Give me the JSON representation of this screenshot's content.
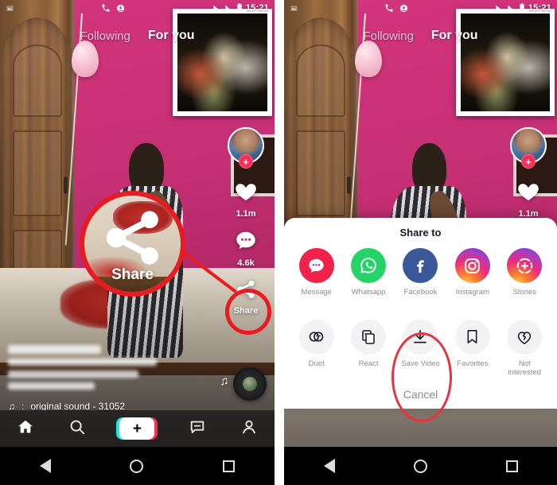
{
  "meta": {
    "description": "Two Android phone screenshots side by side showing TikTok video feed and the Share to sheet with Save Video circled",
    "accent_red": "#e81c20",
    "tiktok_pink": "#fe2c55",
    "tiktok_cyan": "#22e3ea"
  },
  "status_bar": {
    "time": "15:21",
    "icons": [
      "photo-icon",
      "phone-4g-icon",
      "download-icon",
      "signal-icon",
      "wifi-icon",
      "battery-icon"
    ]
  },
  "feed_header": {
    "tabs": [
      {
        "label": "Following",
        "active": false
      },
      {
        "label": "For you",
        "active": true
      }
    ]
  },
  "action_rail": {
    "avatar_badge": "+",
    "items": [
      {
        "icon": "heart-icon",
        "count": "1.1m"
      },
      {
        "icon": "comment-icon",
        "count": "4.6k"
      },
      {
        "icon": "share-icon",
        "count": "Share"
      }
    ]
  },
  "caption": {
    "music_note": "♫",
    "music_separator": ":",
    "music_text": "original sound - 31052"
  },
  "tab_bar": {
    "items": [
      {
        "name": "home",
        "icon": "home-icon"
      },
      {
        "name": "discover",
        "icon": "search-icon"
      },
      {
        "name": "create",
        "icon": "plus-icon",
        "glyph": "+"
      },
      {
        "name": "inbox",
        "icon": "inbox-icon"
      },
      {
        "name": "profile",
        "icon": "person-icon"
      }
    ]
  },
  "system_nav": {
    "back": "back-triangle",
    "home": "home-circle",
    "recents": "recents-square"
  },
  "share_sheet": {
    "title": "Share to",
    "apps": [
      {
        "label": "Message",
        "icon": "message-icon"
      },
      {
        "label": "Whatsapp",
        "icon": "whatsapp-icon"
      },
      {
        "label": "Facebook",
        "icon": "facebook-icon"
      },
      {
        "label": "Instagram",
        "icon": "instagram-icon"
      },
      {
        "label": "Stories",
        "icon": "instagram-stories-icon"
      }
    ],
    "actions": [
      {
        "label": "Duet",
        "icon": "duet-icon"
      },
      {
        "label": "React",
        "icon": "react-icon"
      },
      {
        "label": "Save Video",
        "icon": "download-icon"
      },
      {
        "label": "Favorites",
        "icon": "bookmark-icon"
      },
      {
        "label": "Not interested",
        "icon": "broken-heart-icon"
      }
    ],
    "cancel_label": "Cancel"
  },
  "annotations": {
    "magnifier_label": "Share",
    "highlight_share": "red-circle-share-button",
    "highlight_save_video": "red-oval-save-video"
  }
}
